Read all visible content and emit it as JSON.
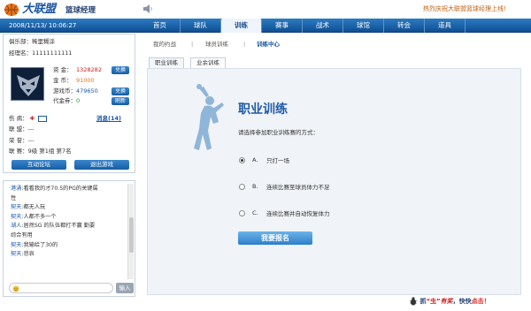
{
  "header": {
    "logo_text": "大联盟",
    "logo_sub": "篮球经理",
    "notice": "热烈庆祝大联盟篮球经理上线!"
  },
  "datebar": "2008/11/13/  10:06:27",
  "nav": {
    "items": [
      {
        "label": "首页"
      },
      {
        "label": "球队"
      },
      {
        "label": "训练"
      },
      {
        "label": "赛事"
      },
      {
        "label": "战术"
      },
      {
        "label": "球馆"
      },
      {
        "label": "转会"
      },
      {
        "label": "道具"
      }
    ]
  },
  "profile": {
    "club_label": "俱乐部：",
    "club_name": "稀里糊涂",
    "manager_label": "经理名：",
    "manager_name": "11111111111",
    "funds_label": "资  金：",
    "funds_value": "1328282",
    "gold_label": "金  币：",
    "gold_value": "91000",
    "game_coin_label": "游戏币：",
    "game_coin_value": "479650",
    "voucher_label": "代金券：",
    "voucher_value": "0",
    "exchange_label": "兑换",
    "refresh_label": "刷新",
    "injury_label": "伤  病：",
    "news_label": "消息(14)",
    "league_label": "联  盟：",
    "league_value": "---",
    "honor_label": "荣  誉：",
    "honor_value": "---",
    "season_label": "联  赛：",
    "season_value": "9级 第1组 第7名",
    "forum_button": "互动论坛",
    "logout_button": "退出游戏"
  },
  "chat": {
    "messages": [
      {
        "user": "港涌",
        "text": ":看看我的才70.5的PG的关键属"
      },
      {
        "user": "",
        "text": "性"
      },
      {
        "user": "契天",
        "text": ":都无人玩"
      },
      {
        "user": "契天",
        "text": ":人都不多一个"
      },
      {
        "user": "湖人",
        "text": ":居然SG 的队伍都打不赢 勤要"
      },
      {
        "user": "",
        "text": "综合有用"
      },
      {
        "user": "契天",
        "text": ":我输给了30的"
      },
      {
        "user": "契天",
        "text": ":悲哀"
      }
    ],
    "input_placeholder": "",
    "send_label": "输入"
  },
  "subnav": {
    "items": [
      {
        "label": "我的约战"
      },
      {
        "label": "球员训练"
      },
      {
        "label": "训练中心"
      }
    ],
    "separator": "|"
  },
  "tabs": [
    {
      "label": "职业训练"
    },
    {
      "label": "业余训练"
    }
  ],
  "training": {
    "title": "职业训练",
    "prompt": "请选择参加职业训练赛的方式：",
    "options": [
      {
        "letter": "A.",
        "label": "只打一场",
        "checked": true
      },
      {
        "letter": "B.",
        "label": "连续比赛至球员体力不足",
        "checked": false
      },
      {
        "letter": "C.",
        "label": "连续比赛并自动恢复体力",
        "checked": false
      }
    ],
    "submit_label": "我要报名"
  },
  "footer": {
    "promo_prefix": "抓",
    "promo_bug": "“虫”",
    "promo_reward": "有奖",
    "promo_middle": "，快快",
    "promo_click": "点击！"
  },
  "colors": {
    "nav_blue": "#1b5fa5",
    "accent_red": "#d21e1e",
    "link_blue": "#1b57a6",
    "title_blue": "#1e5ca8"
  }
}
